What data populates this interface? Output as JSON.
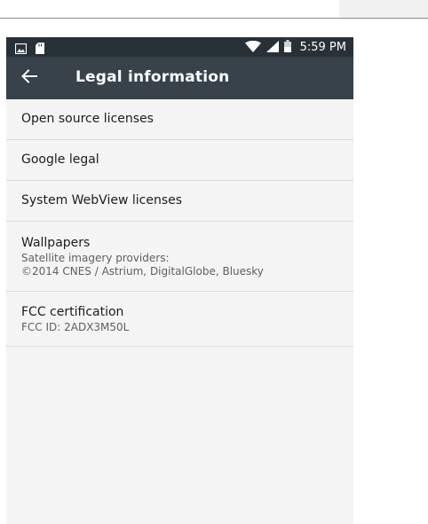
{
  "status_bar": {
    "time": "5:59 PM",
    "left_icons": [
      "image-icon",
      "sd-card-icon"
    ],
    "right_icons": [
      "wifi-icon",
      "signal-icon",
      "battery-icon"
    ]
  },
  "app_bar": {
    "back_icon": "arrow-back-icon",
    "title": "Legal information"
  },
  "items": [
    {
      "title": "Open source licenses"
    },
    {
      "title": "Google legal"
    },
    {
      "title": "System WebView licenses"
    },
    {
      "title": "Wallpapers",
      "subtitle_lines": [
        "Satellite imagery providers:",
        "©2014 CNES / Astrium, DigitalGlobe, Bluesky"
      ]
    },
    {
      "title": "FCC certification",
      "subtitle_lines": [
        "FCC ID: 2ADX3M50L"
      ]
    }
  ],
  "colors": {
    "status_bar": "#283038",
    "app_bar": "#37424b",
    "background": "#f4f4f4",
    "divider": "#dcdcdc"
  }
}
